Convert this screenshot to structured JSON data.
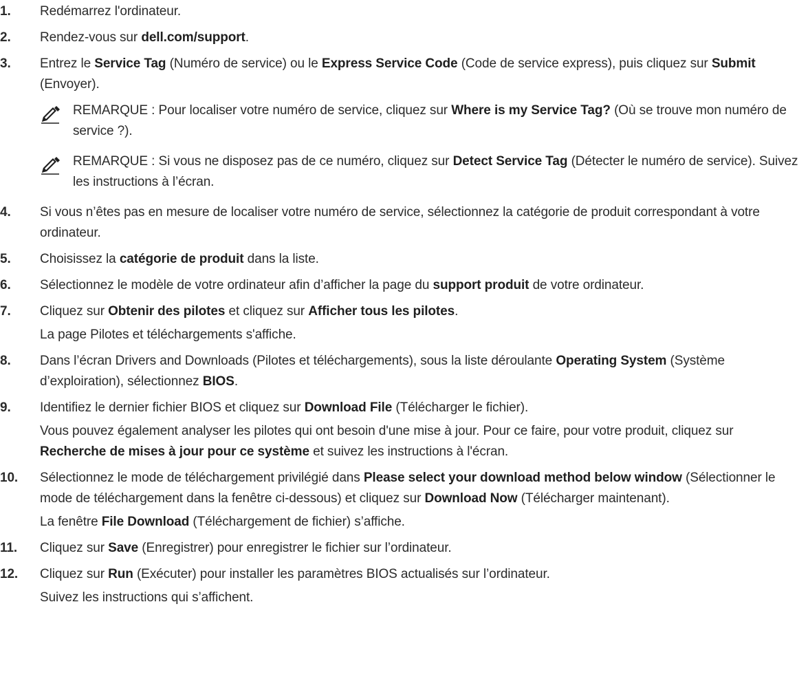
{
  "notes": {
    "label": "REMARQUE :",
    "icon": "pencil-note-icon"
  },
  "steps": [
    {
      "num": "1.",
      "parts": [
        {
          "t": "Redémarrez l'ordinateur."
        }
      ]
    },
    {
      "num": "2.",
      "parts": [
        {
          "t": "Rendez-vous sur "
        },
        {
          "t": "dell.com/support",
          "b": true
        },
        {
          "t": "."
        }
      ]
    },
    {
      "num": "3.",
      "parts": [
        {
          "t": "Entrez le "
        },
        {
          "t": "Service Tag",
          "b": true
        },
        {
          "t": " (Numéro de service) ou le "
        },
        {
          "t": "Express Service Code",
          "b": true
        },
        {
          "t": " (Code de service express), puis cliquez sur "
        },
        {
          "t": "Submit",
          "b": true
        },
        {
          "t": " (Envoyer)."
        }
      ],
      "notes": [
        [
          {
            "t": "Pour localiser votre numéro de service, cliquez sur "
          },
          {
            "t": "Where is my Service Tag?",
            "b": true
          },
          {
            "t": " (Où se trouve mon numéro de service ?)."
          }
        ],
        [
          {
            "t": "Si vous ne disposez pas de ce numéro, cliquez sur "
          },
          {
            "t": "Detect Service Tag",
            "b": true
          },
          {
            "t": " (Détecter le numéro de service). Suivez les instructions à l’écran."
          }
        ]
      ]
    },
    {
      "num": "4.",
      "parts": [
        {
          "t": "Si vous n’êtes pas en mesure de localiser votre numéro de service, sélectionnez la catégorie de produit correspondant à votre ordinateur."
        }
      ]
    },
    {
      "num": "5.",
      "parts": [
        {
          "t": "Choisissez la "
        },
        {
          "t": "catégorie de produit",
          "b": true
        },
        {
          "t": " dans la liste."
        }
      ]
    },
    {
      "num": "6.",
      "parts": [
        {
          "t": "Sélectionnez le modèle de votre ordinateur afin d’afficher la page du "
        },
        {
          "t": "support produit",
          "b": true
        },
        {
          "t": " de votre ordinateur."
        }
      ]
    },
    {
      "num": "7.",
      "parts": [
        {
          "t": "Cliquez sur "
        },
        {
          "t": "Obtenir des pilotes",
          "b": true
        },
        {
          "t": " et cliquez sur "
        },
        {
          "t": "Afficher tous les pilotes",
          "b": true
        },
        {
          "t": "."
        }
      ],
      "sub": [
        [
          {
            "t": "La page Pilotes et téléchargements s'affiche."
          }
        ]
      ]
    },
    {
      "num": "8.",
      "parts": [
        {
          "t": "Dans l’écran Drivers and Downloads (Pilotes et téléchargements), sous la liste déroulante "
        },
        {
          "t": "Operating System",
          "b": true
        },
        {
          "t": " (Système d’exploiration), sélectionnez "
        },
        {
          "t": "BIOS",
          "b": true
        },
        {
          "t": "."
        }
      ]
    },
    {
      "num": "9.",
      "parts": [
        {
          "t": "Identifiez le dernier fichier BIOS et cliquez sur "
        },
        {
          "t": "Download File",
          "b": true
        },
        {
          "t": " (Télécharger le fichier)."
        }
      ],
      "sub": [
        [
          {
            "t": "Vous pouvez également analyser les pilotes qui ont besoin d'une mise à jour. Pour ce faire, pour votre produit, cliquez sur "
          },
          {
            "t": "Recherche de mises à jour pour ce système",
            "b": true
          },
          {
            "t": " et suivez les instructions à l'écran."
          }
        ]
      ]
    },
    {
      "num": "10.",
      "parts": [
        {
          "t": "Sélectionnez le mode de téléchargement privilégié dans "
        },
        {
          "t": "Please select your download method below window",
          "b": true
        },
        {
          "t": " (Sélectionner le mode de téléchargement dans la fenêtre ci-dessous) et cliquez sur "
        },
        {
          "t": "Download Now",
          "b": true
        },
        {
          "t": " (Télécharger maintenant)."
        }
      ],
      "sub": [
        [
          {
            "t": "La fenêtre "
          },
          {
            "t": "File Download",
            "b": true
          },
          {
            "t": " (Téléchargement de fichier) s’affiche."
          }
        ]
      ]
    },
    {
      "num": "11.",
      "parts": [
        {
          "t": "Cliquez sur "
        },
        {
          "t": "Save",
          "b": true
        },
        {
          "t": " (Enregistrer) pour enregistrer le fichier sur l’ordinateur."
        }
      ]
    },
    {
      "num": "12.",
      "parts": [
        {
          "t": "Cliquez sur "
        },
        {
          "t": "Run",
          "b": true
        },
        {
          "t": " (Exécuter) pour installer les paramètres BIOS actualisés sur l’ordinateur."
        }
      ],
      "sub": [
        [
          {
            "t": "Suivez les instructions qui s’affichent."
          }
        ]
      ]
    }
  ]
}
